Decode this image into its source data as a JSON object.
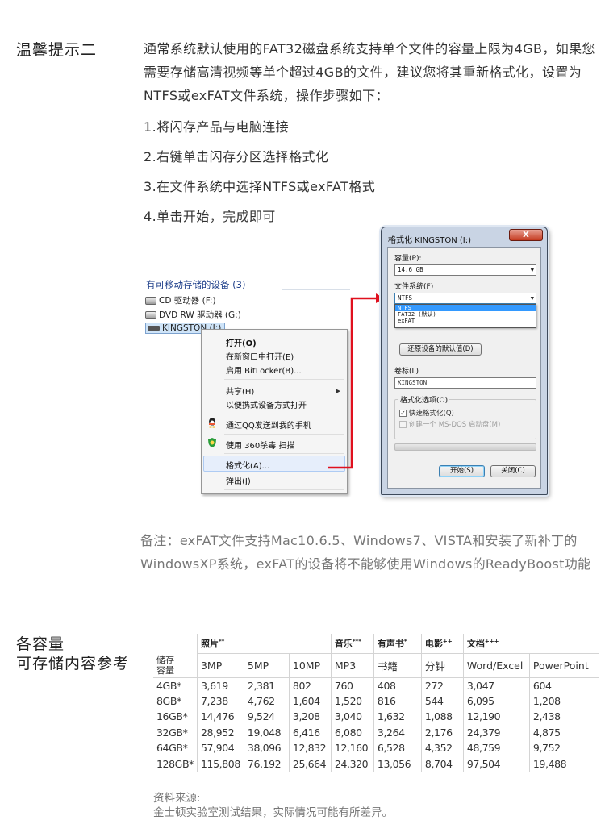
{
  "tip": {
    "title": "温馨提示二",
    "intro": "通常系统默认使用的FAT32磁盘系统支持单个文件的容量上限为4GB，如果您需要存储高清视频等单个超过4GB的文件，建议您将其重新格式化，设置为NTFS或exFAT文件系统，操作步骤如下：",
    "steps": [
      "1.将闪存产品与电脑连接",
      "2.右键单击闪存分区选择格式化",
      "3.在文件系统中选择NTFS或exFAT格式",
      "4.单击开始，完成即可"
    ],
    "note": "备注：exFAT文件支持Mac10.6.5、Windows7、VISTA和安装了新补丁的WindowsXP系统，exFAT的设备将不能够使用Windows的ReadyBoost功能"
  },
  "explorer": {
    "header": "有可移动存储的设备 (3)",
    "devices": [
      "CD 驱动器 (F:)",
      "DVD RW 驱动器 (G:)",
      "KINGSTON (I:)"
    ],
    "menu": [
      "打开(O)",
      "在新窗口中打开(E)",
      "启用 BitLocker(B)...",
      "共享(H)",
      "以便携式设备方式打开",
      "通过QQ发送到我的手机",
      "使用 360杀毒 扫描",
      "格式化(A)...",
      "弹出(J)"
    ]
  },
  "dialog": {
    "title": "格式化 KINGSTON (I:)",
    "close": "X",
    "capacity_label": "容量(P):",
    "capacity_value": "14.6 GB",
    "fs_label": "文件系统(F)",
    "fs_selected": "NTFS",
    "fs_options": [
      "NTFS",
      "FAT32 (默认)",
      "exFAT"
    ],
    "restore_button": "还原设备的默认值(D)",
    "volume_label": "卷标(L)",
    "volume_value": "KINGSTON",
    "options_label": "格式化选项(O)",
    "quick_format": "快速格式化(Q)",
    "msdos_disk": "创建一个 MS-DOS 启动盘(M)",
    "start_button": "开始(S)",
    "close_button": "关闭(C)"
  },
  "capacity": {
    "title_line1": "各容量",
    "title_line2": "可存储内容参考",
    "groups": [
      {
        "label": "照片",
        "mark": "**"
      },
      {
        "label": "音乐",
        "mark": "***"
      },
      {
        "label": "有声书",
        "mark": "*"
      },
      {
        "label": "电影",
        "mark": "++"
      },
      {
        "label": "文档",
        "mark": "+++"
      }
    ],
    "columns": [
      "储存\n容量",
      "3MP",
      "5MP",
      "10MP",
      "MP3",
      "书籍",
      "分钟",
      "Word/Excel",
      "PowerPoint"
    ],
    "rows": [
      [
        "4GB*",
        "3,619",
        "2,381",
        "802",
        "760",
        "408",
        "272",
        "3,047",
        "604"
      ],
      [
        "8GB*",
        "7,238",
        "4,762",
        "1,604",
        "1,520",
        "816",
        "544",
        "6,095",
        "1,208"
      ],
      [
        "16GB*",
        "14,476",
        "9,524",
        "3,208",
        "3,040",
        "1,632",
        "1,088",
        "12,190",
        "2,438"
      ],
      [
        "32GB*",
        "28,952",
        "19,048",
        "6,416",
        "6,080",
        "3,264",
        "2,176",
        "24,379",
        "4,875"
      ],
      [
        "64GB*",
        "57,904",
        "38,096",
        "12,832",
        "12,160",
        "6,528",
        "4,352",
        "48,759",
        "9,752"
      ],
      [
        "128GB*",
        "115,808",
        "76,192",
        "25,664",
        "24,320",
        "13,056",
        "8,704",
        "97,504",
        "19,488"
      ]
    ],
    "source_label": "资料来源:",
    "source_text": "金士顿实验室测试结果，实际情况可能有所差异。"
  },
  "colors": {
    "arrow": "#e0101e",
    "dialog_frame": "#c9d4e4",
    "link_blue": "#1e3f8a"
  }
}
